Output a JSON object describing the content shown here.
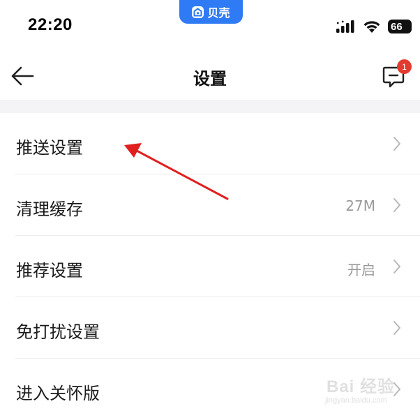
{
  "status_bar": {
    "time": "22:20",
    "app_name": "贝壳",
    "battery": "66",
    "icons": [
      "signal-icon",
      "wifi-icon",
      "battery-icon"
    ]
  },
  "nav": {
    "title": "设置",
    "back_icon": "arrow-left-icon",
    "message_icon": "message-icon",
    "message_badge": "1"
  },
  "settings": {
    "items": [
      {
        "label": "推送设置",
        "value": ""
      },
      {
        "label": "清理缓存",
        "value": "27M"
      },
      {
        "label": "推荐设置",
        "value": "开启"
      },
      {
        "label": "免打扰设置",
        "value": ""
      },
      {
        "label": "进入关怀版",
        "value": ""
      }
    ]
  },
  "annotation": {
    "color": "#e02020"
  },
  "watermark": {
    "text": "Bai 经验",
    "url": "jingyan.baidu.com"
  },
  "colors": {
    "app_pill": "#2f7bf5",
    "badge": "#e23b30",
    "section_gap": "#f4f4f6",
    "value_text": "#9a9a9a"
  }
}
